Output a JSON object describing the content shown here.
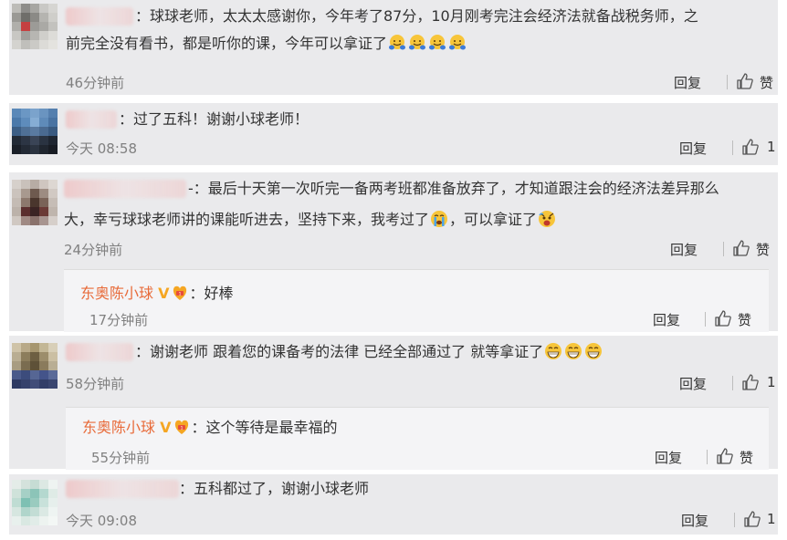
{
  "colors": {
    "block_bg": "#eaeaec",
    "sub_bg": "#f4f4f6",
    "author": "#e86b3a",
    "time": "#808080"
  },
  "comments": [
    {
      "text_line1": "：球球老师，太太太感谢你，今年考了87分，10月刚考完注会经济法就备战税务师，之",
      "text_line2": "前完全没有看书，都是听你的课，今年可以拿证了",
      "emoji": "hugging-icon",
      "time": "46分钟前",
      "reply": "回复",
      "like": "赞"
    },
    {
      "text_line1": "：过了五科！谢谢小球老师！",
      "time": "今天 08:58",
      "reply": "回复",
      "like": "1"
    },
    {
      "text_line1": "-：最后十天第一次听完一备两考班都准备放弃了，才知道跟注会的经济法差异那么",
      "text_line2_a": "大，幸亏球球老师讲的课能听进去，坚持下来，我考过了",
      "text_line2_b": "，可以拿证了",
      "time": "24分钟前",
      "reply": "回复",
      "like": "赞",
      "sub": {
        "author": "东奥陈小球",
        "badge": "V",
        "text": "：好棒",
        "time": "17分钟前",
        "reply": "回复",
        "like": "赞"
      }
    },
    {
      "text_line1": "：谢谢老师 跟着您的课备考的法律  已经全部通过了  就等拿证了",
      "time": "58分钟前",
      "reply": "回复",
      "like": "1",
      "sub": {
        "author": "东奥陈小球",
        "badge": "V",
        "text": "：这个等待是最幸福的",
        "time": "55分钟前",
        "reply": "回复",
        "like": "赞"
      }
    },
    {
      "text_line1": "：五科都过了，谢谢小球老师",
      "time": "今天 09:08",
      "reply": "回复",
      "like": "1"
    }
  ]
}
